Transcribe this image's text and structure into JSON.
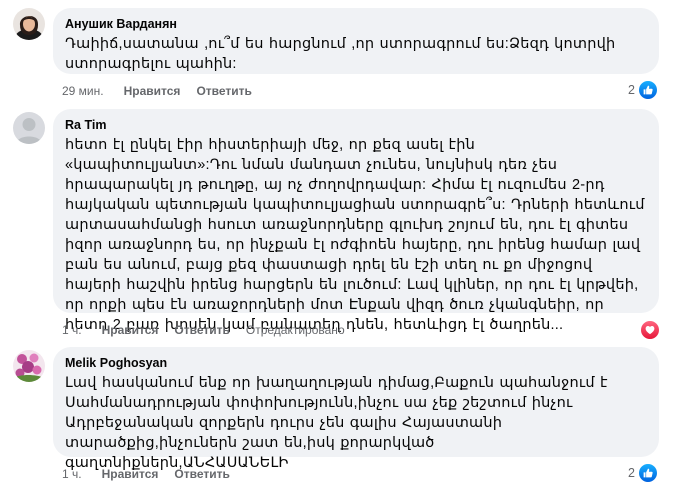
{
  "comments": [
    {
      "author": "Анушик Варданян",
      "text": "Դաիիճ,սատանա ,ու՞մ ես հարցնում ,որ ստորագրում ես:Ձեզդ կոտրվի ստորագրելու պահին:",
      "time": "29 мин.",
      "like_label": "Нравится",
      "reply_label": "Ответить",
      "reaction_count": "2",
      "reaction_icon": "like-icon"
    },
    {
      "author": "Ra Tim",
      "text": "հետո էլ ընկել էիր հիստերիայի մեջ, որ քեզ ասել էին «կապիտուլյանտ»:Դու նման մանդատ չունես, նույնիսկ դեռ չես հրապարակել յդ թուղթը, այ ոչ ժողովրդավար: Հիմա էլ ուզումես 2-րդ հայկական պետության կապիտուլյացիան ստորագրե՞ս: Դրների հետևում արտասահմանցի հսուտ առաջնորդները գլուխդ շոյում են, դու էլ գիտես իզոր առաջնորդ ես, որ ինչքան էլ ոժգիոեն հայերը, դու իրենց համար լավ բան ես անում, բայց քեզ փաստացի դրել են էշի տեղ ու քո միջոցով հայերի հաշվին իրենց հարցերն են լուծում: Լավ կլիներ, որ դու էլ կրթվեի, որ որքի պես էն առաջորդների մոտ Էնքան վիզդ ծուռ չկանգնեիր, որ հետո 2 բառ խոսեն կամ բանատեղ դնեն, հետևիցդ էլ ծաղրեն...",
      "time": "1 ч.",
      "like_label": "Нравится",
      "reply_label": "Ответить",
      "edited_label": "Отредактировано",
      "reaction_icon": "love-icon"
    },
    {
      "author": "Melik Poghosyan",
      "text": "Լավ հասկանում ենք որ խաղաղության դիմաց,Բաքուն պահանջում է Սահմանադրության փոփոխությունն,ինչու սա չեք շեշտում ինչու Ադրբեջանական զորքերն դուրս չեն գալիս Հայաստանի տարածքից,ինչուներն շատ են,իսկ քորարկված գաղտնիքներն,ԱՆՀԱՍԱՆԵԼԻ",
      "time": "1 ч.",
      "like_label": "Нравится",
      "reply_label": "Ответить",
      "reaction_count": "2",
      "reaction_icon": "like-icon"
    }
  ],
  "colors": {
    "bubble": "#f0f2f5",
    "meta": "#65676b",
    "like": "#0866ff",
    "love": "#e61739"
  }
}
